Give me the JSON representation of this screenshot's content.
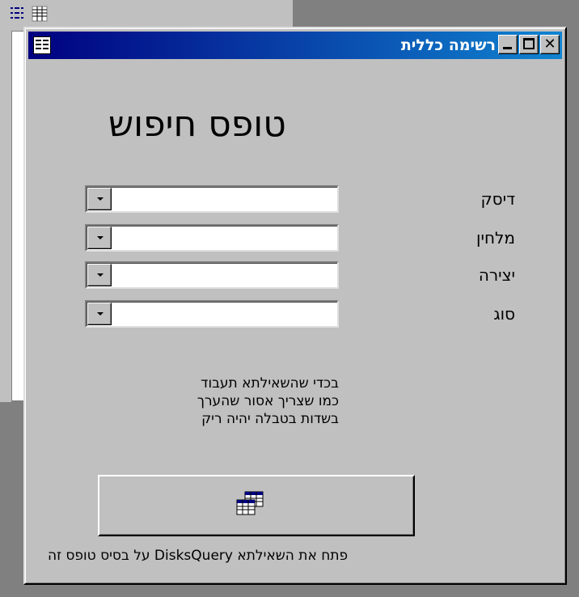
{
  "window": {
    "title": "רשימה כללית"
  },
  "titlebar_buttons": {
    "close": "✕"
  },
  "form": {
    "heading": "טופס חיפוש",
    "fields": [
      {
        "label": "דיסק",
        "value": ""
      },
      {
        "label": "מלחין",
        "value": ""
      },
      {
        "label": "יצירה",
        "value": ""
      },
      {
        "label": "סוג",
        "value": ""
      }
    ],
    "note_lines": [
      "בכדי שהשאילתא תעבוד",
      "כמו שצריך אסור שהערך",
      "בשדות בטבלה יהיה ריק"
    ],
    "open_query_button": {
      "icon": "datasheet-table-icon"
    },
    "open_query_caption": "פתח את השאילתא DisksQuery על בסיס טופס זה"
  },
  "colors": {
    "face": "#c0c0c0",
    "titlebar_start": "#000080",
    "titlebar_end": "#1084d0",
    "mdi_background": "#808080"
  }
}
